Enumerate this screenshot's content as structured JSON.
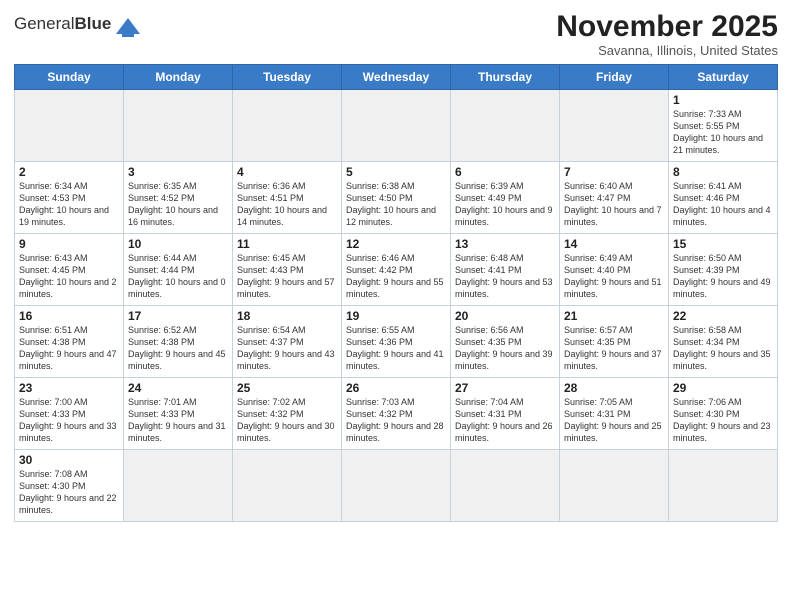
{
  "header": {
    "logo_general": "General",
    "logo_blue": "Blue",
    "month_title": "November 2025",
    "location": "Savanna, Illinois, United States"
  },
  "days_of_week": [
    "Sunday",
    "Monday",
    "Tuesday",
    "Wednesday",
    "Thursday",
    "Friday",
    "Saturday"
  ],
  "weeks": [
    [
      {
        "day": "",
        "info": ""
      },
      {
        "day": "",
        "info": ""
      },
      {
        "day": "",
        "info": ""
      },
      {
        "day": "",
        "info": ""
      },
      {
        "day": "",
        "info": ""
      },
      {
        "day": "",
        "info": ""
      },
      {
        "day": "1",
        "info": "Sunrise: 7:33 AM\nSunset: 5:55 PM\nDaylight: 10 hours\nand 21 minutes."
      }
    ],
    [
      {
        "day": "2",
        "info": "Sunrise: 6:34 AM\nSunset: 4:53 PM\nDaylight: 10 hours\nand 19 minutes."
      },
      {
        "day": "3",
        "info": "Sunrise: 6:35 AM\nSunset: 4:52 PM\nDaylight: 10 hours\nand 16 minutes."
      },
      {
        "day": "4",
        "info": "Sunrise: 6:36 AM\nSunset: 4:51 PM\nDaylight: 10 hours\nand 14 minutes."
      },
      {
        "day": "5",
        "info": "Sunrise: 6:38 AM\nSunset: 4:50 PM\nDaylight: 10 hours\nand 12 minutes."
      },
      {
        "day": "6",
        "info": "Sunrise: 6:39 AM\nSunset: 4:49 PM\nDaylight: 10 hours\nand 9 minutes."
      },
      {
        "day": "7",
        "info": "Sunrise: 6:40 AM\nSunset: 4:47 PM\nDaylight: 10 hours\nand 7 minutes."
      },
      {
        "day": "8",
        "info": "Sunrise: 6:41 AM\nSunset: 4:46 PM\nDaylight: 10 hours\nand 4 minutes."
      }
    ],
    [
      {
        "day": "9",
        "info": "Sunrise: 6:43 AM\nSunset: 4:45 PM\nDaylight: 10 hours\nand 2 minutes."
      },
      {
        "day": "10",
        "info": "Sunrise: 6:44 AM\nSunset: 4:44 PM\nDaylight: 10 hours\nand 0 minutes."
      },
      {
        "day": "11",
        "info": "Sunrise: 6:45 AM\nSunset: 4:43 PM\nDaylight: 9 hours\nand 57 minutes."
      },
      {
        "day": "12",
        "info": "Sunrise: 6:46 AM\nSunset: 4:42 PM\nDaylight: 9 hours\nand 55 minutes."
      },
      {
        "day": "13",
        "info": "Sunrise: 6:48 AM\nSunset: 4:41 PM\nDaylight: 9 hours\nand 53 minutes."
      },
      {
        "day": "14",
        "info": "Sunrise: 6:49 AM\nSunset: 4:40 PM\nDaylight: 9 hours\nand 51 minutes."
      },
      {
        "day": "15",
        "info": "Sunrise: 6:50 AM\nSunset: 4:39 PM\nDaylight: 9 hours\nand 49 minutes."
      }
    ],
    [
      {
        "day": "16",
        "info": "Sunrise: 6:51 AM\nSunset: 4:38 PM\nDaylight: 9 hours\nand 47 minutes."
      },
      {
        "day": "17",
        "info": "Sunrise: 6:52 AM\nSunset: 4:38 PM\nDaylight: 9 hours\nand 45 minutes."
      },
      {
        "day": "18",
        "info": "Sunrise: 6:54 AM\nSunset: 4:37 PM\nDaylight: 9 hours\nand 43 minutes."
      },
      {
        "day": "19",
        "info": "Sunrise: 6:55 AM\nSunset: 4:36 PM\nDaylight: 9 hours\nand 41 minutes."
      },
      {
        "day": "20",
        "info": "Sunrise: 6:56 AM\nSunset: 4:35 PM\nDaylight: 9 hours\nand 39 minutes."
      },
      {
        "day": "21",
        "info": "Sunrise: 6:57 AM\nSunset: 4:35 PM\nDaylight: 9 hours\nand 37 minutes."
      },
      {
        "day": "22",
        "info": "Sunrise: 6:58 AM\nSunset: 4:34 PM\nDaylight: 9 hours\nand 35 minutes."
      }
    ],
    [
      {
        "day": "23",
        "info": "Sunrise: 7:00 AM\nSunset: 4:33 PM\nDaylight: 9 hours\nand 33 minutes."
      },
      {
        "day": "24",
        "info": "Sunrise: 7:01 AM\nSunset: 4:33 PM\nDaylight: 9 hours\nand 31 minutes."
      },
      {
        "day": "25",
        "info": "Sunrise: 7:02 AM\nSunset: 4:32 PM\nDaylight: 9 hours\nand 30 minutes."
      },
      {
        "day": "26",
        "info": "Sunrise: 7:03 AM\nSunset: 4:32 PM\nDaylight: 9 hours\nand 28 minutes."
      },
      {
        "day": "27",
        "info": "Sunrise: 7:04 AM\nSunset: 4:31 PM\nDaylight: 9 hours\nand 26 minutes."
      },
      {
        "day": "28",
        "info": "Sunrise: 7:05 AM\nSunset: 4:31 PM\nDaylight: 9 hours\nand 25 minutes."
      },
      {
        "day": "29",
        "info": "Sunrise: 7:06 AM\nSunset: 4:30 PM\nDaylight: 9 hours\nand 23 minutes."
      }
    ],
    [
      {
        "day": "30",
        "info": "Sunrise: 7:08 AM\nSunset: 4:30 PM\nDaylight: 9 hours\nand 22 minutes."
      },
      {
        "day": "",
        "info": ""
      },
      {
        "day": "",
        "info": ""
      },
      {
        "day": "",
        "info": ""
      },
      {
        "day": "",
        "info": ""
      },
      {
        "day": "",
        "info": ""
      },
      {
        "day": "",
        "info": ""
      }
    ]
  ]
}
